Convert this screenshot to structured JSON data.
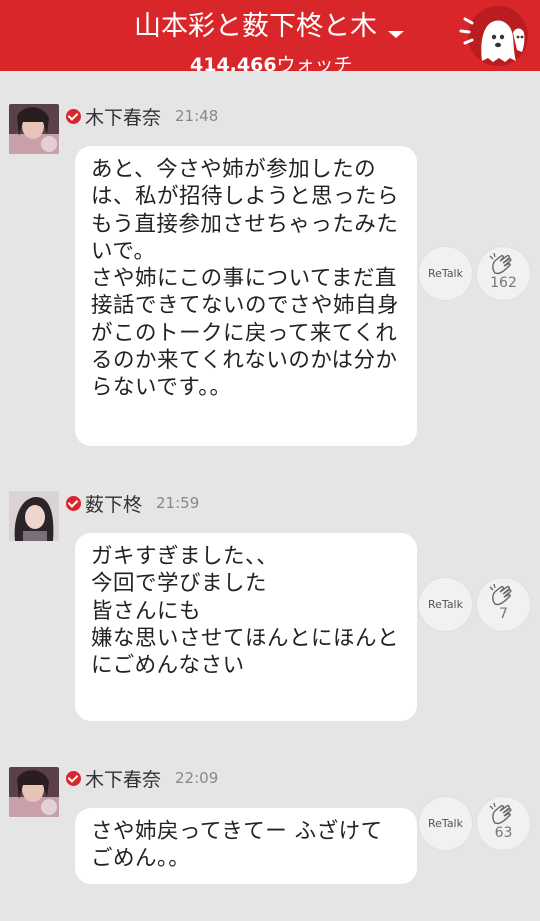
{
  "header": {
    "title": "山本彩と薮下柊と木",
    "watch_count": "414,466",
    "watch_label": "ウォッチ",
    "colors": {
      "header_bg": "#d8262a",
      "verified": "#d8262a"
    },
    "mascot_icon": "ghost-mascot-icon"
  },
  "messages": [
    {
      "sender": "木下春奈",
      "time": "21:48",
      "text": "あと、今さや姉が参加したのは、私が招待しようと思ったらもう直接参加させちゃったみたいで。\nさや姉にこの事についてまだ直接話できてないのでさや姉自身がこのトークに戻って来てくれるのか来てくれないのかは分からないです。。",
      "retalk_label": "ReTalk",
      "clap_count": "162"
    },
    {
      "sender": "薮下柊",
      "time": "21:59",
      "text": "ガキすぎました、、\n今回で学びました\n皆さんにも\n嫌な思いさせてほんとにほんとにごめんなさい",
      "retalk_label": "ReTalk",
      "clap_count": "7"
    },
    {
      "sender": "木下春奈",
      "time": "22:09",
      "text": "さや姉戻ってきてー ふざけてごめん。。",
      "retalk_label": "ReTalk",
      "clap_count": "63"
    }
  ]
}
